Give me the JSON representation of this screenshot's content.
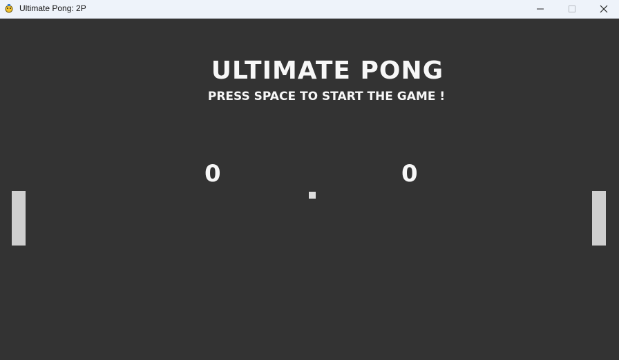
{
  "window": {
    "title": "Ultimate Pong: 2P",
    "icon": "pygame-snake-icon",
    "controls": [
      "minimize-icon",
      "maximize-icon",
      "close-icon"
    ]
  },
  "game": {
    "title": "ULTIMATE PONG",
    "subtitle": "PRESS SPACE TO START THE GAME !",
    "scores": {
      "left": "0",
      "right": "0"
    },
    "colors": {
      "background": "#333333",
      "foreground": "#f7f7f7",
      "paddle": "#cfcfcf",
      "ball": "#dedede"
    }
  }
}
